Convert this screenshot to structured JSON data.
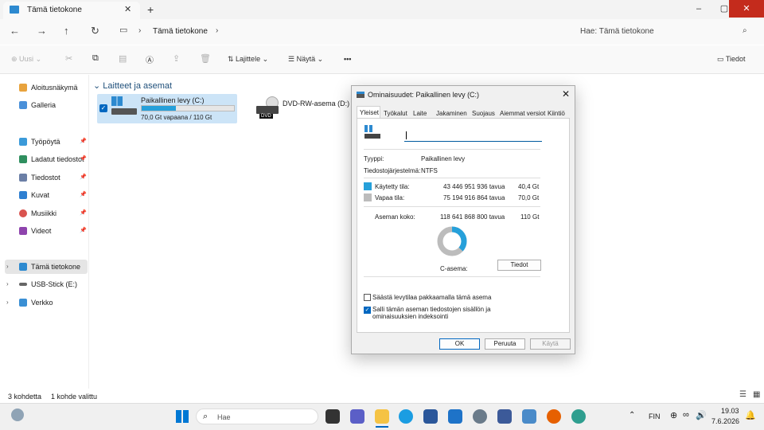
{
  "tab": {
    "title": "Tämä tietokone"
  },
  "window": {
    "minimize": "–",
    "maximize": "▢",
    "close": "✕"
  },
  "nav": {
    "breadcrumb": "Tämä tietokone",
    "search_placeholder": "Hae: Tämä tietokone"
  },
  "toolbar": {
    "new": "Uusi",
    "sort": "Lajittele",
    "view": "Näytä",
    "more": "•••",
    "details": "Tiedot"
  },
  "sidebar": {
    "quick": [
      {
        "label": "Aloitusnäkymä"
      },
      {
        "label": "Galleria"
      }
    ],
    "pinned": [
      {
        "label": "Työpöytä"
      },
      {
        "label": "Ladatut tiedostot"
      },
      {
        "label": "Tiedostot"
      },
      {
        "label": "Kuvat"
      },
      {
        "label": "Musiikki"
      },
      {
        "label": "Videot"
      }
    ],
    "tree": [
      {
        "label": "Tämä tietokone"
      },
      {
        "label": "USB-Stick (E:)"
      },
      {
        "label": "Verkko"
      }
    ]
  },
  "main": {
    "group": "Laitteet ja asemat",
    "drive_c": {
      "name": "Paikallinen levy (C:)",
      "free": "70,0 Gt vapaana / 110 Gt",
      "used_fraction": 0.368
    },
    "dvd": {
      "name": "DVD-RW-asema (D:)",
      "badge": "DVD"
    }
  },
  "status": {
    "count": "3 kohdetta",
    "selected": "1 kohde valittu"
  },
  "dialog": {
    "title": "Ominaisuudet: Paikallinen levy (C:)",
    "tabs": [
      "Yleiset",
      "Työkalut",
      "Laite",
      "Jakaminen",
      "Suojaus",
      "Aiemmat versiot",
      "Kiintiö"
    ],
    "name_value": "",
    "type_label": "Tyyppi:",
    "type_value": "Paikallinen levy",
    "fs_label": "Tiedostojärjestelmä:",
    "fs_value": "NTFS",
    "used_label": "Käytetty tila:",
    "used_bytes": "43 446 951 936 tavua",
    "used_gb": "40,4 Gt",
    "free_label": "Vapaa tila:",
    "free_bytes": "75 194 916 864 tavua",
    "free_gb": "70,0 Gt",
    "cap_label": "Aseman koko:",
    "cap_bytes": "118 641 868 800 tavua",
    "cap_gb": "110 Gt",
    "drive_label": "C-asema:",
    "details_button": "Tiedot",
    "compress_label": "Säästä levytilaa pakkaamalla tämä asema",
    "index_label": "Salli tämän aseman tiedostojen sisällön ja ominaisuuksien indeksointi",
    "ok": "OK",
    "cancel": "Peruuta",
    "apply": "Käytä",
    "colors": {
      "used": "#26a0da",
      "free": "#bcbcbc"
    }
  },
  "taskbar": {
    "search": "Hae",
    "lang": "FIN",
    "time": "19.03",
    "date": "7.6.2026"
  }
}
